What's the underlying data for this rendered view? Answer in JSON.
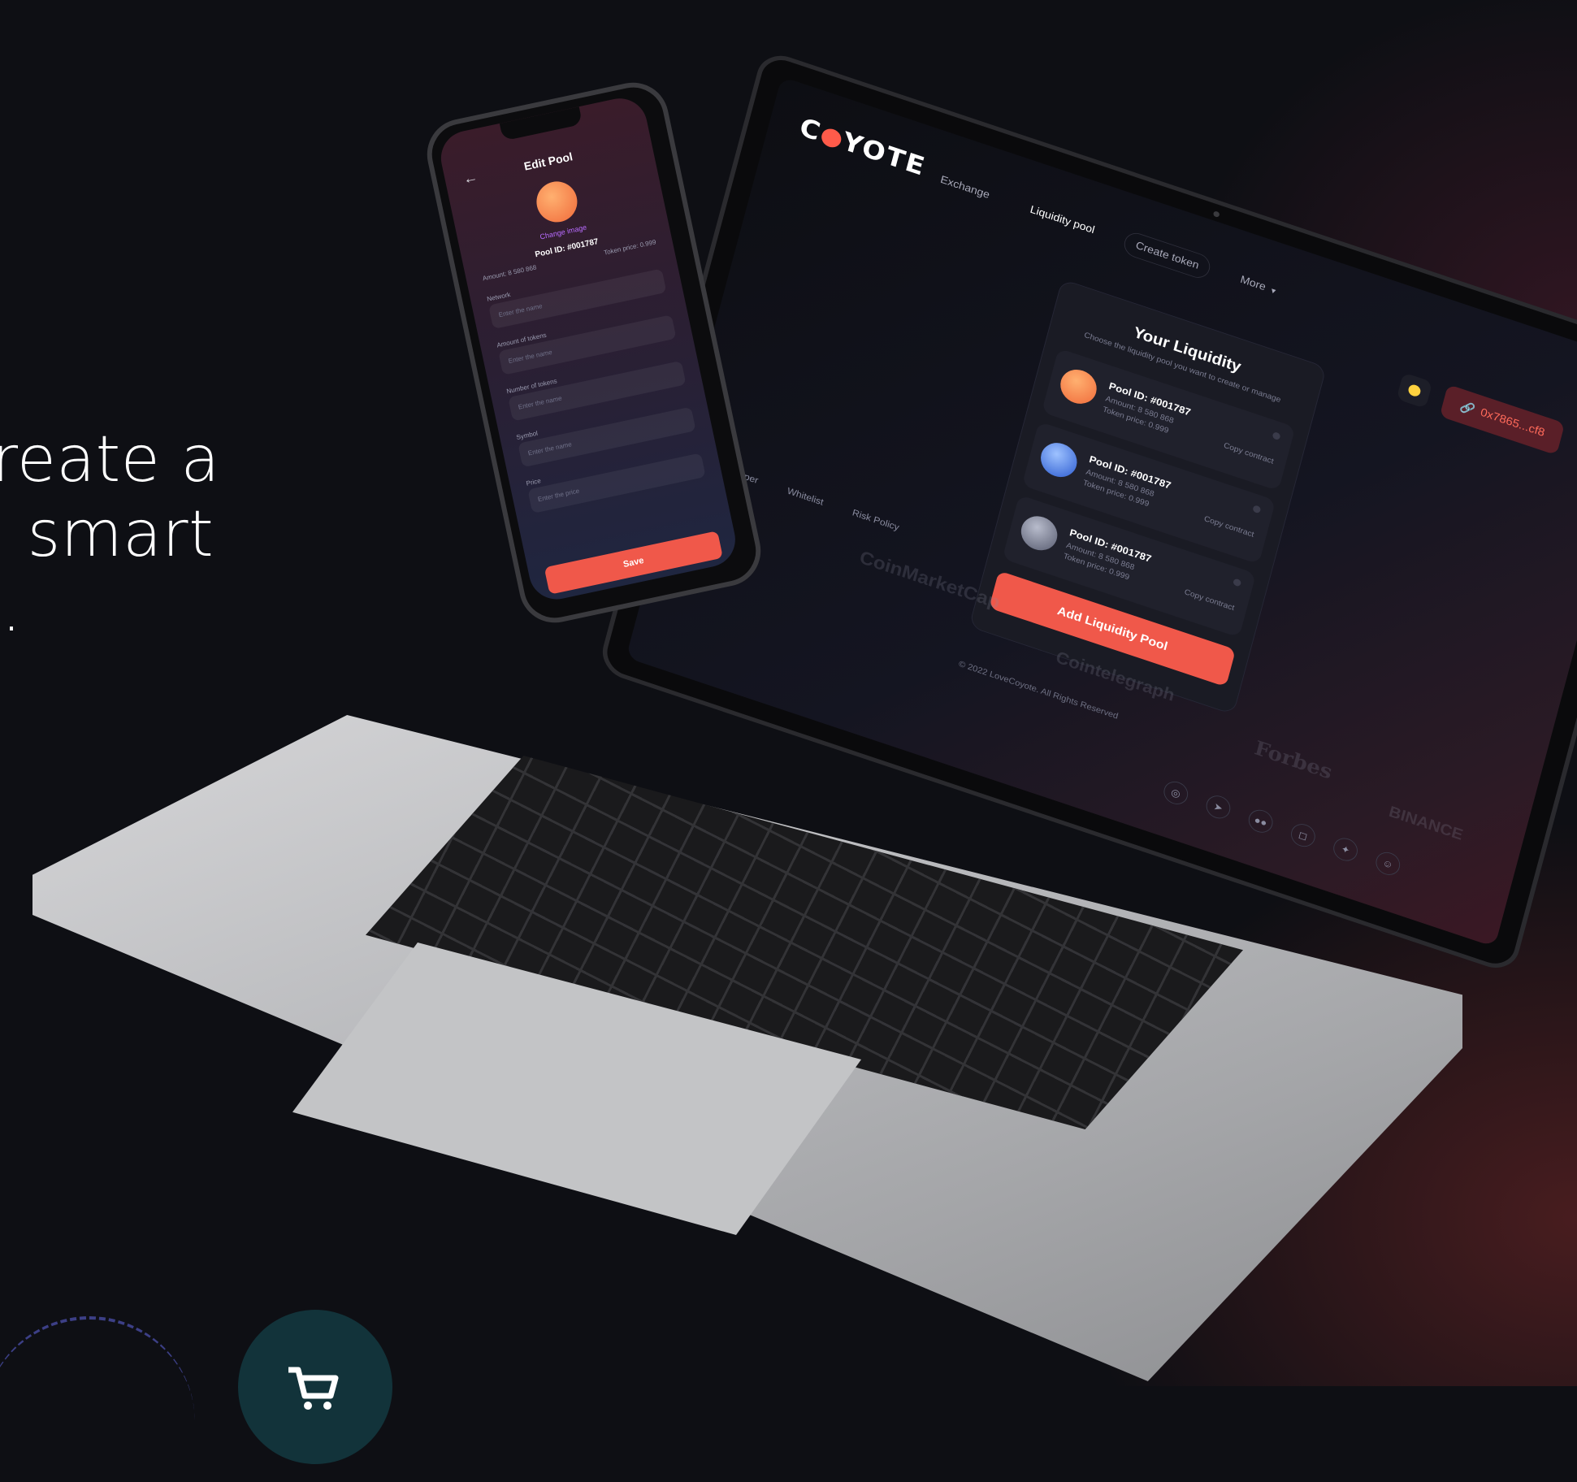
{
  "hero": {
    "line1": "reate a",
    "line2": "a smart",
    "line3": "B."
  },
  "laptop": {
    "logo": {
      "prefix": "C",
      "suffix": "YOTE"
    },
    "nav": [
      {
        "label": "Exchange"
      },
      {
        "label": "Liquidity pool"
      },
      {
        "label": "Create token"
      },
      {
        "label": "More"
      }
    ],
    "wallet_label": "0x7865...cf8",
    "card": {
      "title": "Your Liquidity",
      "subtitle": "Choose the liquidity pool you want to create or manage",
      "pools": [
        {
          "id": "Pool ID: #001787",
          "amount": "Amount: 8 580 868",
          "price": "Token price: 0.999",
          "copy": "Copy contract",
          "color": "#f07a3a"
        },
        {
          "id": "Pool ID: #001787",
          "amount": "Amount: 8 580 868",
          "price": "Token price: 0.999",
          "copy": "Copy contract",
          "color": "#3a6ad8"
        },
        {
          "id": "Pool ID: #001787",
          "amount": "Amount: 8 580 868",
          "price": "Token price: 0.999",
          "copy": "Copy contract",
          "color": "#7a7e92"
        }
      ],
      "add_button": "Add Liquidity Pool"
    },
    "footer_links": [
      {
        "label": "Whitepaper"
      },
      {
        "label": "Whitelist"
      },
      {
        "label": "Risk Policy"
      }
    ],
    "copyright": "© 2022 LoveCoyote. All Rights Reserved",
    "brands": [
      "CoinMarketCap",
      "Cointelegraph",
      "Forbes",
      "BINANCE"
    ],
    "socials": [
      "discord-icon",
      "telegram-icon",
      "medium-icon",
      "instagram-icon",
      "twitter-icon",
      "reddit-icon"
    ]
  },
  "phone": {
    "title": "Edit Pool",
    "change_image": "Change image",
    "pool_id": "Pool ID: #001787",
    "meta_left": "Amount: 8 580 868",
    "meta_right": "Token price: 0.999",
    "fields": [
      {
        "label": "Network",
        "placeholder": "Enter the name"
      },
      {
        "label": "Amount of tokens",
        "placeholder": "Enter the name"
      },
      {
        "label": "Number of tokens",
        "placeholder": "Enter the name"
      },
      {
        "label": "Symbol",
        "placeholder": "Enter the name"
      },
      {
        "label": "Price",
        "placeholder": "Enter the price"
      }
    ],
    "save_button": "Save"
  },
  "colors": {
    "accent": "#f0584a",
    "background": "#0e0f14",
    "cart_circle": "#12333a"
  }
}
